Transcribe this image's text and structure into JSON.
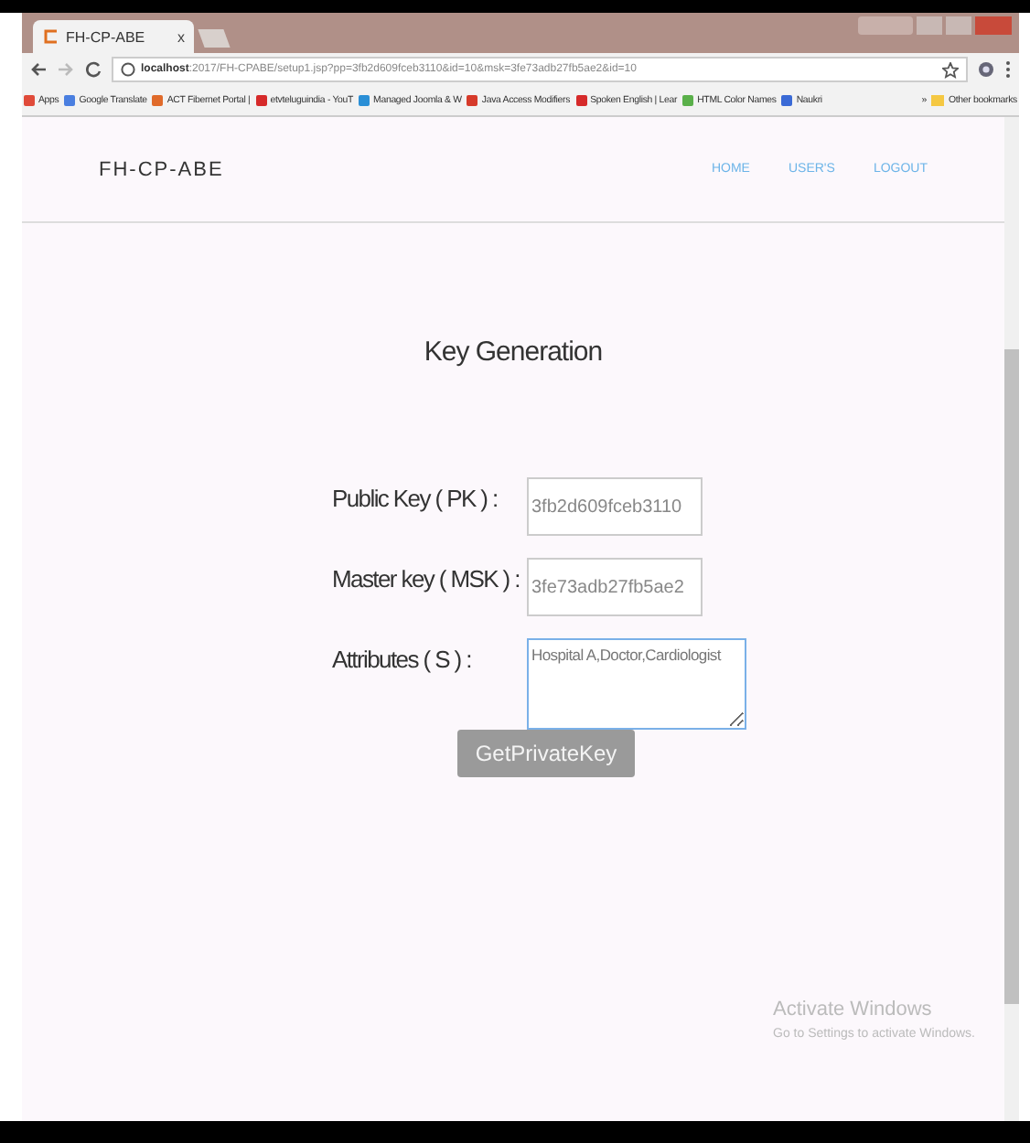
{
  "browser": {
    "tab_title": "FH-CP-ABE",
    "tab_close": "x",
    "url_host": "localhost",
    "url_rest": ":2017/FH-CPABE/setup1.jsp?pp=3fb2d609fceb3110&id=10&msk=3fe73adb27fb5ae2&id=10",
    "bookmarks": [
      {
        "label": "Apps",
        "color": "#e04b3a"
      },
      {
        "label": "Google Translate",
        "color": "#4a7fe0"
      },
      {
        "label": "ACT Fibernet Portal |",
        "color": "#e06a2a"
      },
      {
        "label": "etvteluguindia - YouT",
        "color": "#d62a2a"
      },
      {
        "label": "Managed Joomla & W",
        "color": "#2a8fd6"
      },
      {
        "label": "Java Access Modifiers",
        "color": "#d63a2a"
      },
      {
        "label": "Spoken English | Lear",
        "color": "#d62a2a"
      },
      {
        "label": "HTML Color Names",
        "color": "#5ab04a"
      },
      {
        "label": "Naukri",
        "color": "#3a6ad6"
      }
    ],
    "more": "»",
    "other_bookmarks": "Other bookmarks"
  },
  "navbar": {
    "brand": "FH-CP-ABE",
    "links": [
      "HOME",
      "USER'S",
      "LOGOUT"
    ]
  },
  "form": {
    "title": "Key Generation",
    "fields": [
      {
        "label": "Public Key ( PK ) :",
        "value": "3fb2d609fceb3110",
        "kind": "input"
      },
      {
        "label": "Master key ( MSK ) :",
        "value": "3fe73adb27fb5ae2",
        "kind": "input"
      },
      {
        "label": "Attributes ( S ) :",
        "value": "Hospital A,Doctor,Cardiologist",
        "kind": "textarea"
      }
    ],
    "button": "GetPrivateKey"
  },
  "activation": {
    "title": "Activate Windows",
    "subtitle": "Go to Settings to activate Windows."
  }
}
